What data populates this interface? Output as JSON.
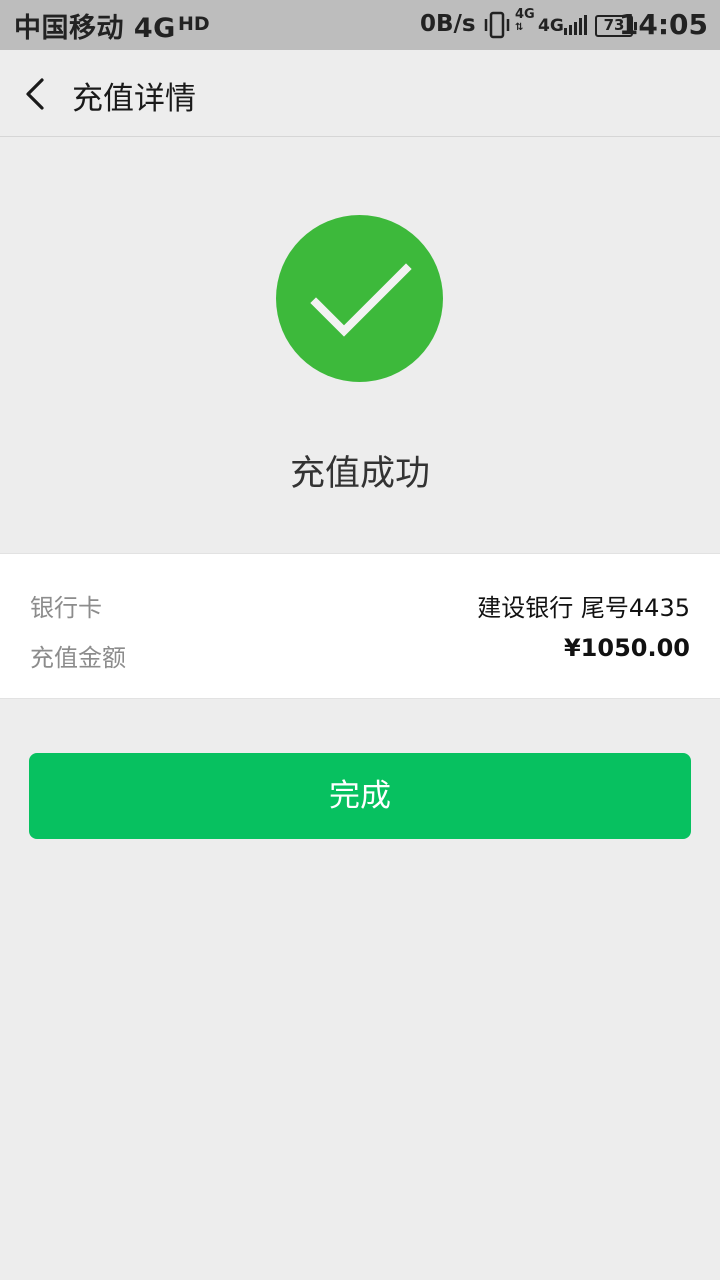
{
  "status_bar": {
    "carrier": "中国移动 4G",
    "hd": "HD",
    "speed": "0B/s",
    "network_small": "4G",
    "network": "4G",
    "battery": "73",
    "time": "14:05"
  },
  "nav": {
    "title": "充值详情",
    "back_icon": "chevron-left-icon"
  },
  "result": {
    "icon": "check-circle-icon",
    "icon_color": "#3db93b",
    "text": "充值成功"
  },
  "details": {
    "bank_label": "银行卡",
    "bank_value": "建设银行 尾号4435",
    "amount_label": "充值金额",
    "amount_value": "¥1050.00"
  },
  "actions": {
    "done_label": "完成",
    "done_color": "#07c160"
  }
}
